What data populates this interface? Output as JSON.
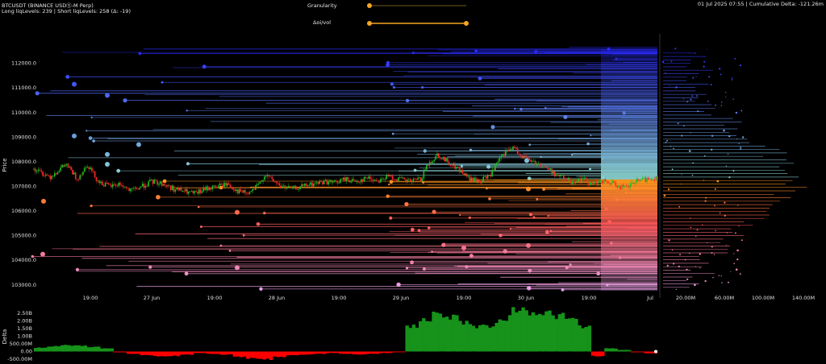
{
  "header": {
    "title": "BTCUSDT (BINANCE USDⓈ-M Perp)",
    "liq_levels": "Long liqLevels: 239 | Short liqLevels: 258 (Δ: -19)",
    "timestamp": "01 Jul 2025 07:55 | Cumulative Delta: -121.26m"
  },
  "controls": {
    "granularity_label": "Granularity",
    "granularity_value": 0.0,
    "oi_vol_label": "Δoi/vol",
    "oi_vol_range": [
      0.0,
      1.0
    ],
    "slider_color": "#f5a623"
  },
  "chart_data": [
    {
      "type": "candlestick",
      "name": "price",
      "ylabel": "Price",
      "ylim": [
        102600,
        113200
      ],
      "y_ticks": [
        103000,
        104000,
        105000,
        106000,
        107000,
        108000,
        109000,
        110000,
        111000,
        112000
      ],
      "y_tick_labels": [
        "103000.0",
        "104000.0",
        "105000.0",
        "106000.0",
        "107000.0",
        "108000.0",
        "109000.0",
        "110000.0",
        "111000.0",
        "112000.0"
      ],
      "x_tick_labels": [
        "19:00",
        "27 Jun",
        "19:00",
        "28 Jun",
        "19:00",
        "29 Jun",
        "19:00",
        "30 Jun",
        "19:00",
        "Jul"
      ],
      "price_path": [
        [
          0,
          107700
        ],
        [
          3,
          107400
        ],
        [
          6,
          107900
        ],
        [
          8,
          107300
        ],
        [
          10,
          107900
        ],
        [
          12,
          107200
        ],
        [
          14,
          107000
        ],
        [
          16,
          107100
        ],
        [
          18,
          106800
        ],
        [
          20,
          107000
        ],
        [
          22,
          107200
        ],
        [
          24,
          107100
        ],
        [
          26,
          106900
        ],
        [
          28,
          106800
        ],
        [
          30,
          106700
        ],
        [
          32,
          106900
        ],
        [
          34,
          107000
        ],
        [
          36,
          107100
        ],
        [
          38,
          106800
        ],
        [
          40,
          106700
        ],
        [
          42,
          107100
        ],
        [
          43,
          107500
        ],
        [
          44,
          107300
        ],
        [
          46,
          107000
        ],
        [
          48,
          106900
        ],
        [
          50,
          107000
        ],
        [
          52,
          107100
        ],
        [
          54,
          107200
        ],
        [
          56,
          107150
        ],
        [
          58,
          107300
        ],
        [
          60,
          107200
        ],
        [
          62,
          107350
        ],
        [
          64,
          107250
        ],
        [
          66,
          107400
        ],
        [
          68,
          107300
        ],
        [
          70,
          107200
        ],
        [
          72,
          107300
        ],
        [
          73,
          107800
        ],
        [
          75,
          108300
        ],
        [
          77,
          108000
        ],
        [
          79,
          107700
        ],
        [
          81,
          107300
        ],
        [
          83,
          107200
        ],
        [
          85,
          107500
        ],
        [
          87,
          108200
        ],
        [
          89,
          108600
        ],
        [
          91,
          108200
        ],
        [
          93,
          108000
        ],
        [
          95,
          107800
        ],
        [
          97,
          107500
        ],
        [
          99,
          107300
        ],
        [
          100,
          107200
        ],
        [
          102,
          107300
        ],
        [
          104,
          107100
        ],
        [
          106,
          107200
        ],
        [
          108,
          107100
        ],
        [
          110,
          106900
        ],
        [
          112,
          107200
        ],
        [
          114,
          107300
        ],
        [
          116,
          107350
        ]
      ],
      "liquidation_levels_long_color_low": "#e8a0e8",
      "liquidation_levels_long_color_mid": "#ff5a5a",
      "liquidation_levels_long_color_high": "#ff9a1a",
      "liquidation_levels_short_color_low": "#8ad0d0",
      "liquidation_levels_short_color_high": "#2a2aff",
      "current_price": 107300
    },
    {
      "type": "bar",
      "name": "volume_profile",
      "x_ticks": [
        "20.00M",
        "60.00M",
        "100.00M",
        "140.00M"
      ]
    },
    {
      "type": "bar",
      "name": "cumulative_delta",
      "ylabel": "Delta",
      "ylim": [
        -500000000,
        2700000000
      ],
      "y_tick_labels": [
        "2.50B",
        "2.00B",
        "1.50B",
        "1.00B",
        "500.00M",
        "0.00",
        "-500.00M"
      ],
      "y_ticks": [
        2500000000,
        2000000000,
        1500000000,
        1000000000,
        500000000,
        0,
        -500000000
      ],
      "segments": [
        [
          0,
          250000000
        ],
        [
          1,
          350000000
        ],
        [
          2,
          400000000
        ],
        [
          3,
          380000000
        ],
        [
          4,
          300000000
        ],
        [
          5,
          200000000
        ],
        [
          6,
          -50000000
        ],
        [
          7,
          -150000000
        ],
        [
          8,
          -250000000
        ],
        [
          9,
          -300000000
        ],
        [
          10,
          -280000000
        ],
        [
          11,
          -200000000
        ],
        [
          12,
          -100000000
        ],
        [
          13,
          -150000000
        ],
        [
          14,
          -200000000
        ],
        [
          15,
          -350000000
        ],
        [
          16,
          -450000000
        ],
        [
          17,
          -500000000
        ],
        [
          18,
          -350000000
        ],
        [
          19,
          -250000000
        ],
        [
          20,
          -200000000
        ],
        [
          21,
          -150000000
        ],
        [
          22,
          -100000000
        ],
        [
          23,
          -150000000
        ],
        [
          24,
          -200000000
        ],
        [
          25,
          -150000000
        ],
        [
          26,
          -100000000
        ],
        [
          27,
          -50000000
        ],
        [
          28,
          1600000000
        ],
        [
          29,
          2100000000
        ],
        [
          30,
          2400000000
        ],
        [
          31,
          2300000000
        ],
        [
          32,
          1900000000
        ],
        [
          33,
          1600000000
        ],
        [
          34,
          1700000000
        ],
        [
          35,
          2200000000
        ],
        [
          36,
          2750000000
        ],
        [
          37,
          2600000000
        ],
        [
          38,
          2500000000
        ],
        [
          39,
          2300000000
        ],
        [
          40,
          2100000000
        ],
        [
          41,
          1600000000
        ],
        [
          42,
          -300000000
        ],
        [
          43,
          200000000
        ],
        [
          44,
          100000000
        ],
        [
          45,
          -50000000
        ],
        [
          46,
          -120000000
        ]
      ],
      "positive_color": "#17921a",
      "negative_color": "#ff0000"
    }
  ]
}
